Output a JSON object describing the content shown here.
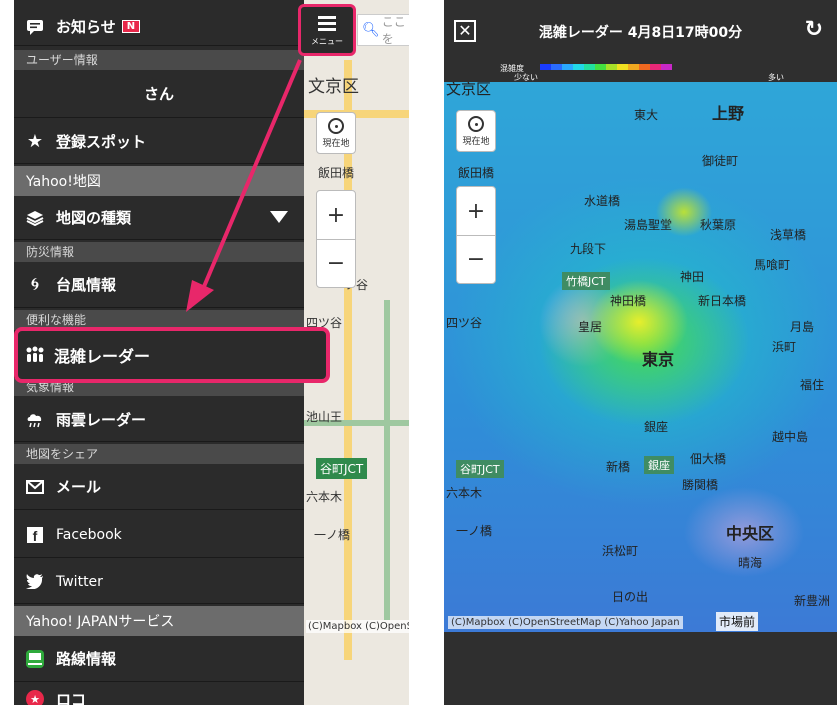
{
  "left": {
    "menu_button_label": "メニュー",
    "search_placeholder": "ここを",
    "map_labels": [
      "文京区",
      "飯田橋",
      "一ツ谷",
      "四ツ谷",
      "六本木",
      "一ノ橋",
      "池山王",
      "谷町JCT"
    ],
    "map_credit": "(C)Mapbox (C)OpenS",
    "zoom_in": "+",
    "zoom_out": "−",
    "locate_label": "現在地",
    "drawer": {
      "notice_label": "お知らせ",
      "notice_badge": "N",
      "user_section": "ユーザー情報",
      "user_name": "さん",
      "saved_spots": "登録スポット",
      "yahoo_map_head": "Yahoo!地図",
      "map_types": "地図の種類",
      "disaster_section": "防災情報",
      "typhoon": "台風情報",
      "useful_section": "便利な機能",
      "congestion_radar": "混雑レーダー",
      "weather_section": "気象情報",
      "rain_radar": "雨雲レーダー",
      "share_section": "地図をシェア",
      "mail": "メール",
      "facebook": "Facebook",
      "twitter": "Twitter",
      "yahoo_services_head": "Yahoo! JAPANサービス",
      "route_info": "路線情報",
      "last_item": "ロコ"
    }
  },
  "right": {
    "title": "混雑レーダー 4月8日17時00分",
    "legend": {
      "title": "混雑度",
      "less": "少ない",
      "more": "多い",
      "colors": [
        "#1a3cff",
        "#2a6cff",
        "#2aa8ff",
        "#22d8e8",
        "#22e0a0",
        "#44e040",
        "#a8e028",
        "#f0e020",
        "#f0a820",
        "#f06820",
        "#e82878",
        "#c828c8"
      ]
    },
    "locate_label": "現在地",
    "zoom_in": "+",
    "zoom_out": "−",
    "map_labels": {
      "bunkyo": "文京区",
      "ueno": "上野",
      "higashi_ueno": "東大",
      "okachimachi": "御徒町",
      "iidabashi": "飯田橋",
      "suidobashi": "水道橋",
      "yushima": "湯島聖堂",
      "akihabara": "秋葉原",
      "asakusabashi": "浅草橋",
      "kudanshita": "九段下",
      "kanda": "神田",
      "bakurocho": "馬喰町",
      "takebashi": "竹橋JCT",
      "shin_nihonbashi": "新日本橋",
      "kojimachi": "皇居",
      "jimbocho": "神田橋",
      "tokyo": "東京",
      "hamacho": "浜町",
      "yotsuya": "四ツ谷",
      "ginza": "銀座",
      "tanimachi": "谷町JCT",
      "shinbashi": "新橋",
      "ginza2": "銀座",
      "shiodome": "佃大橋",
      "roppongi": "六本木",
      "ichinohashi": "一ノ橋",
      "hamamatsucho": "浜松町",
      "chuo": "中央区",
      "harumi": "晴海",
      "hinode": "日の出",
      "shintoyosu": "新豊洲",
      "kachidoki": "勝関橋",
      "tsukishima": "月島",
      "fukagawa": "福住",
      "kiba": "越中島"
    },
    "credit": "(C)Mapbox (C)OpenStreetMap (C)Yahoo Japan",
    "bottom_label": "市場前"
  }
}
